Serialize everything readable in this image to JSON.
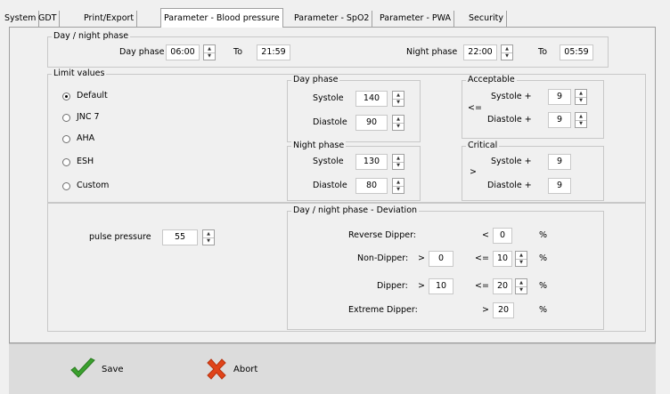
{
  "tabs": [
    "System",
    "GDT",
    "Print/Export",
    "Parameter - Blood pressure",
    "Parameter - SpO2",
    "Parameter - PWA",
    "Security"
  ],
  "day_night": {
    "title": "Day / night phase",
    "day_label": "Day phase",
    "day_from": "06:00",
    "to_label": "To",
    "day_to": "21:59",
    "night_label": "Night phase",
    "night_from": "22:00",
    "night_to": "05:59"
  },
  "limits": {
    "title": "Limit values",
    "options": [
      "Default",
      "JNC 7",
      "AHA",
      "ESH",
      "Custom"
    ],
    "selected": "Default"
  },
  "day_phase": {
    "title": "Day phase",
    "systole_label": "Systole",
    "systole": "140",
    "diastole_label": "Diastole",
    "diastole": "90"
  },
  "night_phase": {
    "title": "Night phase",
    "systole_label": "Systole",
    "systole": "130",
    "diastole_label": "Diastole",
    "diastole": "80"
  },
  "acceptable": {
    "title": "Acceptable",
    "op": "<=",
    "systole_label": "Systole +",
    "systole": "9",
    "diastole_label": "Diastole +",
    "diastole": "9"
  },
  "critical": {
    "title": "Critical",
    "op": ">",
    "systole_label": "Systole +",
    "systole": "9",
    "diastole_label": "Diastole +",
    "diastole": "9"
  },
  "pulse": {
    "label": "pulse pressure",
    "value": "55"
  },
  "deviation": {
    "title": "Day / night phase - Deviation",
    "reverse_label": "Reverse Dipper:",
    "reverse_op": "<",
    "reverse_val": "0",
    "non_label": "Non-Dipper:",
    "non_gt": ">",
    "non_low": "0",
    "non_le": "<=",
    "non_high": "10",
    "dipper_label": "Dipper:",
    "dipper_gt": ">",
    "dipper_low": "10",
    "dipper_le": "<=",
    "dipper_high": "20",
    "extreme_label": "Extreme Dipper:",
    "extreme_op": ">",
    "extreme_val": "20",
    "percent": "%"
  },
  "footer": {
    "save_label": "Save",
    "abort_label": "Abort"
  },
  "colors": {
    "save_check": "#3aa12e",
    "abort_x": "#e0441a"
  }
}
